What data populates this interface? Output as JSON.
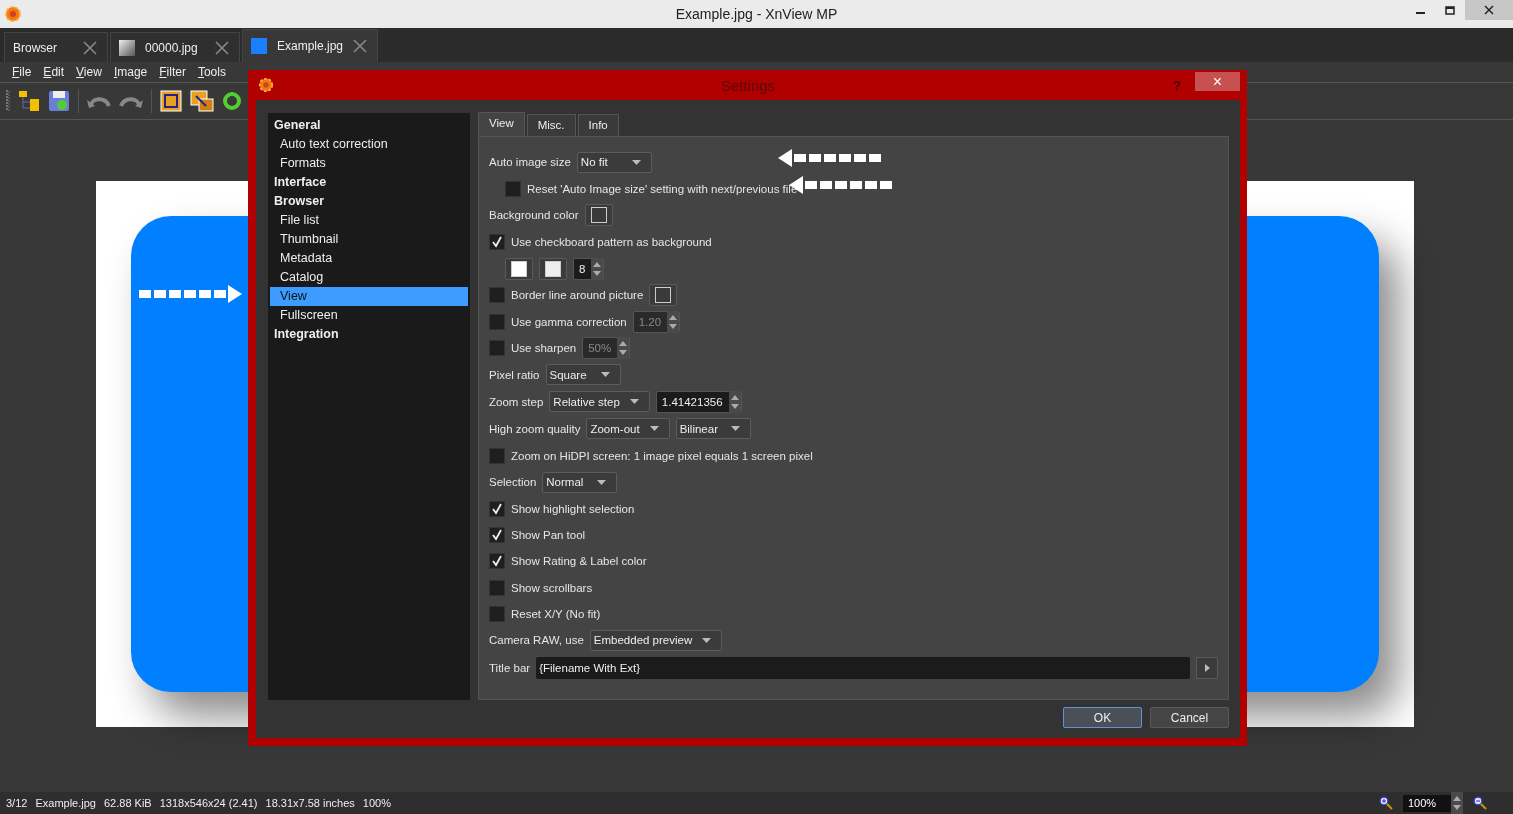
{
  "window": {
    "title": "Example.jpg - XnView MP"
  },
  "tabs": [
    {
      "label": "Browser",
      "selected": false,
      "kind": "browser"
    },
    {
      "label": "00000.jpg",
      "selected": false,
      "kind": "image"
    },
    {
      "label": "Example.jpg",
      "selected": true,
      "kind": "image"
    }
  ],
  "menu": [
    "File",
    "Edit",
    "View",
    "Image",
    "Filter",
    "Tools"
  ],
  "dialog": {
    "title": "Settings",
    "help": "?",
    "close": "×",
    "nav": [
      {
        "label": "General",
        "selected": false,
        "children": [
          {
            "label": "Auto text correction",
            "selected": false
          },
          {
            "label": "Formats",
            "selected": false
          }
        ]
      },
      {
        "label": "Interface",
        "selected": false
      },
      {
        "label": "Browser",
        "selected": false,
        "children": [
          {
            "label": "File list",
            "selected": false
          },
          {
            "label": "Thumbnail",
            "selected": false
          },
          {
            "label": "Metadata",
            "selected": false
          },
          {
            "label": "Catalog",
            "selected": false
          },
          {
            "label": "View",
            "selected": true
          },
          {
            "label": "Fullscreen",
            "selected": false
          }
        ]
      },
      {
        "label": "Integration",
        "selected": false
      }
    ],
    "tabs": [
      {
        "label": "View",
        "selected": true
      },
      {
        "label": "Misc.",
        "selected": false
      },
      {
        "label": "Info",
        "selected": false
      }
    ],
    "rows": [
      {
        "kind": "field",
        "label": "Auto image size",
        "controls": [
          {
            "kind": "select",
            "value": "No fit"
          }
        ],
        "children": [
          {
            "kind": "check",
            "label": "Reset 'Auto Image size' setting with next/previous file",
            "checked": false
          }
        ]
      },
      {
        "kind": "field",
        "label": "Background color",
        "controls": [
          {
            "kind": "swatch",
            "color": "#3a3a3a"
          }
        ]
      },
      {
        "kind": "check",
        "label": "Use checkboard pattern as background",
        "checked": true,
        "children": [
          {
            "kind": "field",
            "controls": [
              {
                "kind": "swatch",
                "color": "#ffffff"
              },
              {
                "kind": "swatch",
                "color": "#eeeeee"
              },
              {
                "kind": "spin",
                "value": "8",
                "disabled": false
              }
            ]
          }
        ]
      },
      {
        "kind": "check",
        "label": "Border line around picture",
        "checked": false,
        "controls": [
          {
            "kind": "swatch",
            "color": "#3a3a3a"
          }
        ]
      },
      {
        "kind": "check",
        "label": "Use gamma correction",
        "checked": false,
        "controls": [
          {
            "kind": "spin",
            "value": "1.20",
            "disabled": true
          }
        ]
      },
      {
        "kind": "check",
        "label": "Use sharpen",
        "checked": false,
        "controls": [
          {
            "kind": "spin",
            "value": "50%",
            "disabled": true
          }
        ]
      },
      {
        "kind": "field",
        "label": "Pixel ratio",
        "controls": [
          {
            "kind": "select",
            "value": "Square"
          }
        ]
      },
      {
        "kind": "field",
        "label": "Zoom step",
        "controls": [
          {
            "kind": "select",
            "value": "Relative step"
          },
          {
            "kind": "spin",
            "value": "1.41421356",
            "disabled": false
          }
        ]
      },
      {
        "kind": "field",
        "label": "High zoom quality",
        "controls": [
          {
            "kind": "select",
            "value": "Zoom-out"
          },
          {
            "kind": "select",
            "value": "Bilinear"
          }
        ]
      },
      {
        "kind": "check",
        "label": "Zoom on HiDPI screen: 1 image pixel equals 1 screen pixel",
        "checked": false
      },
      {
        "kind": "field",
        "label": "Selection",
        "controls": [
          {
            "kind": "select",
            "value": "Normal"
          }
        ]
      },
      {
        "kind": "check",
        "label": "Show highlight selection",
        "checked": true
      },
      {
        "kind": "check",
        "label": "Show Pan tool",
        "checked": true
      },
      {
        "kind": "check",
        "label": "Show Rating & Label color",
        "checked": true
      },
      {
        "kind": "check",
        "label": "Show scrollbars",
        "checked": false
      },
      {
        "kind": "check",
        "label": "Reset X/Y (No fit)",
        "checked": false
      },
      {
        "kind": "field",
        "label": "Camera RAW, use",
        "controls": [
          {
            "kind": "select",
            "value": "Embedded preview"
          }
        ]
      },
      {
        "kind": "field",
        "label": "Title bar",
        "controls": [
          {
            "kind": "text",
            "value": "{Filename With Ext}"
          },
          {
            "kind": "arrow_button"
          }
        ]
      }
    ],
    "buttons": [
      {
        "label": "OK",
        "default": true
      },
      {
        "label": "Cancel",
        "default": false
      }
    ]
  },
  "status_bar": {
    "items": [
      "3/12",
      "Example.jpg",
      "62.88 KiB",
      "1318x546x24 (2.41)",
      "18.31x7.58 inches",
      "100%"
    ],
    "zoom": "100%"
  }
}
